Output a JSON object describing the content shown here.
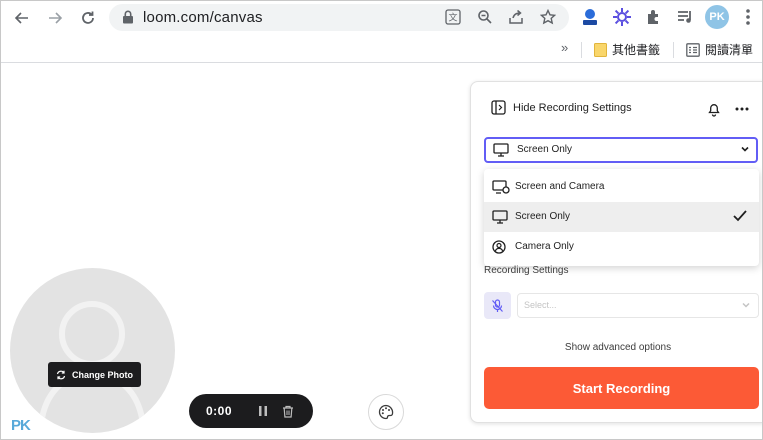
{
  "browser": {
    "url": "loom.com/canvas",
    "avatar_initials": "PK",
    "bookmarks": {
      "overflow_label": "»",
      "other_bookmarks": "其他書籤",
      "reading_list": "閱讀清單"
    }
  },
  "canvas": {
    "change_photo_label": "Change Photo",
    "timer": "0:00",
    "watermark": "PK"
  },
  "panel": {
    "header_label": "Hide Recording Settings",
    "mode_select": {
      "value": "Screen Only"
    },
    "mode_options": [
      {
        "label": "Screen and Camera",
        "icon": "screen-camera-icon",
        "selected": false
      },
      {
        "label": "Screen Only",
        "icon": "monitor-icon",
        "selected": true
      },
      {
        "label": "Camera Only",
        "icon": "camera-only-icon",
        "selected": false
      }
    ],
    "recording_settings_label": "Recording Settings",
    "mic_select_placeholder": "Select...",
    "advanced_label": "Show advanced options",
    "start_button_label": "Start Recording"
  },
  "colors": {
    "accent": "#625df5",
    "start_button": "#fc5a36",
    "pill_background": "#1c1c1e"
  }
}
